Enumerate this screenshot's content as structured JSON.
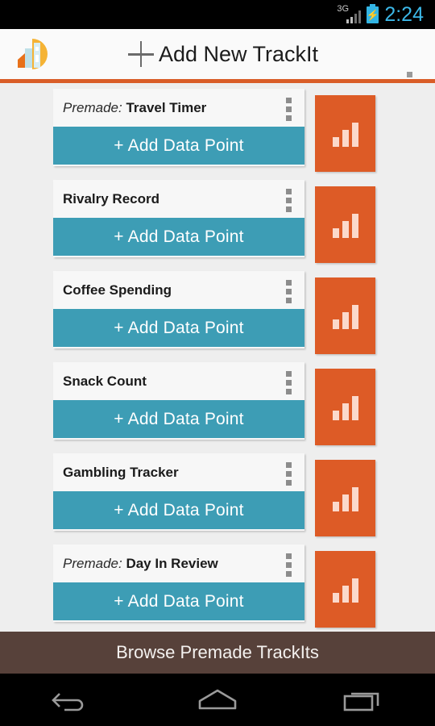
{
  "status_bar": {
    "network_label": "3G",
    "signal_icon": "signal-bars-icon",
    "battery_icon": "battery-charging-icon",
    "time": "2:24",
    "time_color": "#3cb8e8"
  },
  "action_bar": {
    "logo_icon": "app-logo-icon",
    "add_icon": "plus-icon",
    "title": "Add New TrackIt",
    "overflow_icon": "overflow-menu-icon",
    "accent_color": "#d95d28"
  },
  "list": {
    "add_button_label": "+ Add Data Point",
    "premade_prefix": "Premade:",
    "chart_tile_icon": "bar-chart-icon",
    "row_overflow_icon": "overflow-menu-icon",
    "button_color": "#3d9db5",
    "tile_color": "#dd5b26",
    "items": [
      {
        "premade": "Premade:",
        "title": "Travel Timer"
      },
      {
        "premade": "",
        "title": "Rivalry Record"
      },
      {
        "premade": "",
        "title": "Coffee Spending"
      },
      {
        "premade": "",
        "title": "Snack Count"
      },
      {
        "premade": "",
        "title": "Gambling Tracker"
      },
      {
        "premade": "Premade:",
        "title": "Day In Review"
      }
    ]
  },
  "browse_bar": {
    "label": "Browse Premade TrackIts",
    "background_color": "#57413a"
  },
  "nav_bar": {
    "back_icon": "back-arrow-icon",
    "home_icon": "home-icon",
    "recents_icon": "recent-apps-icon"
  }
}
